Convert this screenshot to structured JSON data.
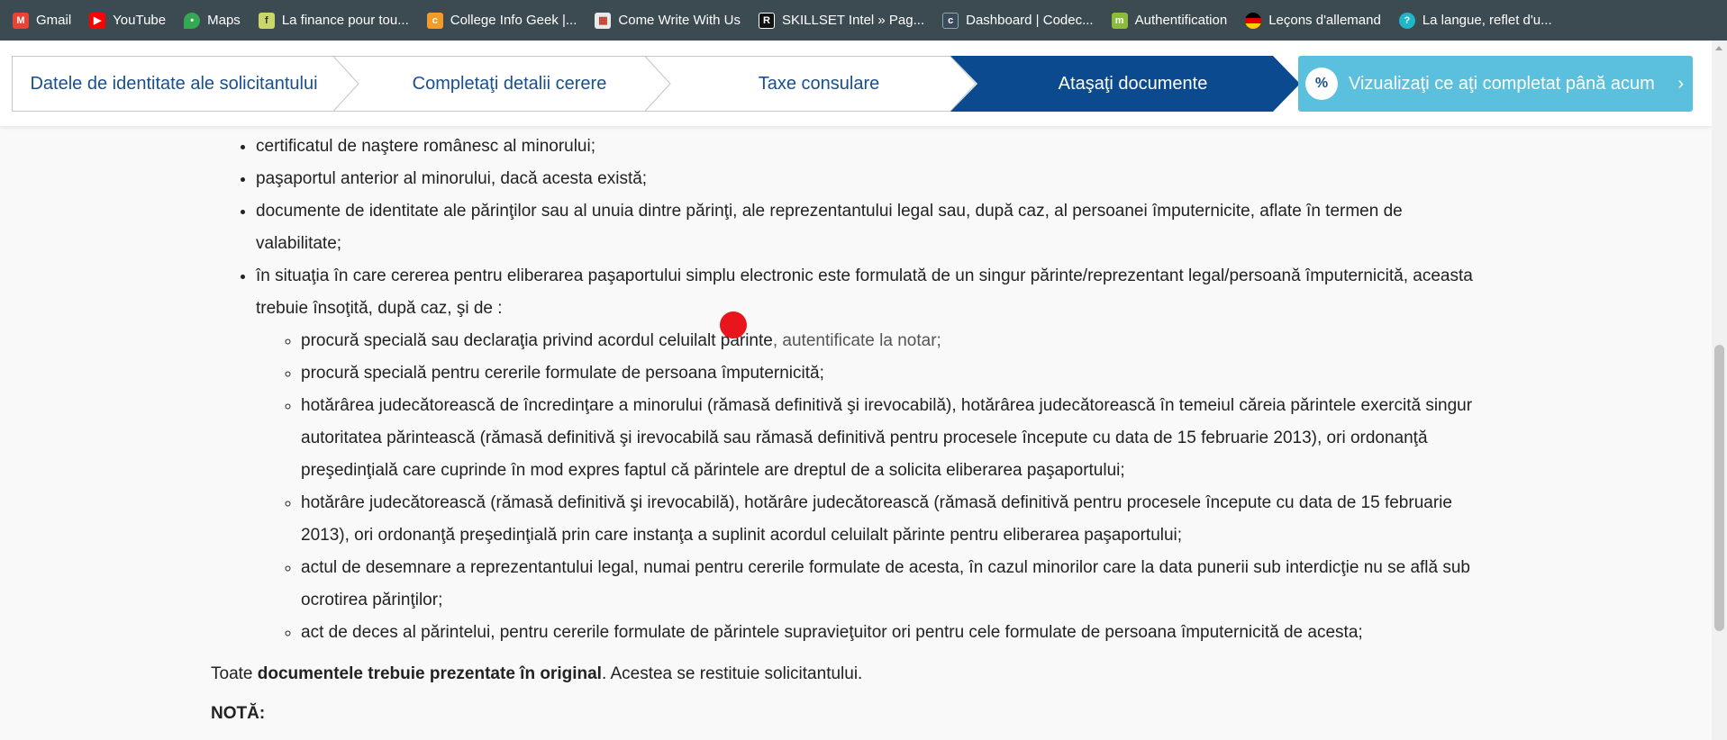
{
  "bookmarks": [
    {
      "label": "Gmail",
      "icon": "gmail-icon",
      "color": "#ea4335"
    },
    {
      "label": "YouTube",
      "icon": "youtube-icon",
      "color": "#ff0000"
    },
    {
      "label": "Maps",
      "icon": "maps-icon",
      "color": "#34a853"
    },
    {
      "label": "La finance pour tou...",
      "icon": "finance-icon",
      "color": "#c9d66a"
    },
    {
      "label": "College Info Geek |...",
      "icon": "college-info-geek-icon",
      "color": "#f29b26"
    },
    {
      "label": "Come Write With Us",
      "icon": "come-write-icon",
      "color": "#e9e9e9"
    },
    {
      "label": "SKILLSET Intel » Pag...",
      "icon": "skillset-icon",
      "color": "#111111"
    },
    {
      "label": "Dashboard | Codec...",
      "icon": "codecademy-icon",
      "color": "#3b4a5a"
    },
    {
      "label": "Authentification",
      "icon": "authentification-icon",
      "color": "#8bbd3a"
    },
    {
      "label": "Leçons d'allemand",
      "icon": "german-flag-icon",
      "color": "#dd0000"
    },
    {
      "label": "La langue, reflet d'u...",
      "icon": "langue-icon",
      "color": "#1fb6c8"
    }
  ],
  "steps": [
    {
      "label": "Datele de identitate ale solicitantului",
      "active": false
    },
    {
      "label": "Completaţi detalii cerere",
      "active": false
    },
    {
      "label": "Taxe consulare",
      "active": false
    },
    {
      "label": "Ataşaţi documente",
      "active": true
    }
  ],
  "summary_button": {
    "icon": "%",
    "label": "Vizualizaţi ce aţi completat până acum",
    "chevron": "›"
  },
  "colors": {
    "active_step": "#0b4a8f",
    "step_text": "#1a4f8f",
    "summary_bg": "#5bc0de",
    "bookmarks_bg": "#3c4a52"
  },
  "content": {
    "items": [
      "certificatul de naştere românesc al minorului;",
      "paşaportul anterior al minorului, dacă acesta există;",
      "documente de identitate ale părinţilor sau al unuia dintre părinţi, ale reprezentantului legal sau, după caz, al persoanei împuternicite, aflate în termen de valabilitate;",
      "în situaţia în care cererea pentru eliberarea paşaportului simplu electronic este formulată de un singur părinte/reprezentant legal/persoană împuternicită, aceasta trebuie însoţită, după caz, şi de :"
    ],
    "subitem_1_main": "procură specială sau declaraţia privind acordul celuilalt părinte",
    "subitem_1_muted": ", autentificate la notar;",
    "subitems": [
      "procură specială pentru cererile formulate de persoana împuternicită;",
      "hotărârea judecătorească de încredinţare a minorului (rămasă definitivă şi irevocabilă), hotărârea judecătorească în temeiul căreia părintele exercită singur autoritatea părintească (rămasă definitivă şi irevocabilă sau rămasă definitivă pentru procesele începute cu data de 15 februarie 2013), ori ordonanţă preşedinţială care cuprinde în mod expres faptul că părintele are dreptul de a solicita eliberarea paşaportului;",
      "hotărâre judecătorească (rămasă definitivă şi irevocabilă), hotărâre judecătorească (rămasă definitivă pentru procesele începute cu data de 15 februarie 2013), ori ordonanţă preşedinţială prin care instanţa a suplinit acordul celuilalt părinte pentru eliberarea paşaportului;",
      "actul de desemnare a reprezentantului legal, numai pentru cererile formulate de acesta, în cazul minorilor care la data punerii sub interdicţie nu se află sub ocrotirea părinţilor;",
      "act de deces al părintelui, pentru cererile formulate de părintele supravieţuitor ori pentru cele formulate de persoana împuternicită de acesta;"
    ],
    "para_prefix": "Toate ",
    "para_bold": "documentele trebuie prezentate în original",
    "para_suffix": ". Acestea se restituie solicitantului.",
    "note": "NOTĂ:"
  }
}
